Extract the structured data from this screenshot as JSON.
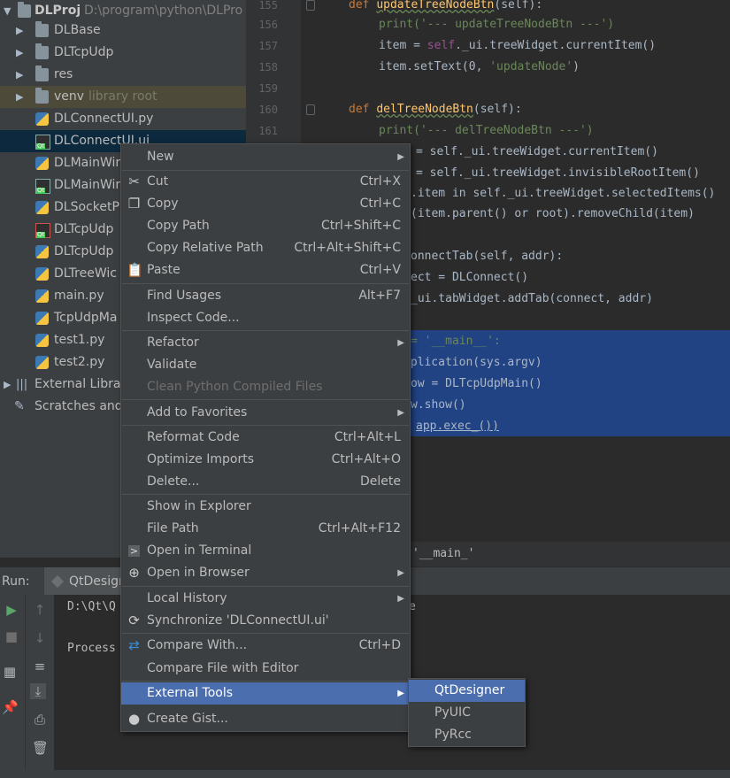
{
  "project": {
    "root_name": "DLProj",
    "root_path": "D:\\program\\python\\DLPro",
    "items": [
      {
        "label": "DLBase",
        "type": "folder"
      },
      {
        "label": "DLTcpUdp",
        "type": "folder"
      },
      {
        "label": "res",
        "type": "folder"
      },
      {
        "label": "venv",
        "hint": "library root",
        "type": "folder"
      },
      {
        "label": "DLConnectUI.py",
        "type": "py"
      },
      {
        "label": "DLConnectUI.ui",
        "type": "ui"
      },
      {
        "label": "DLMainWir",
        "type": "py"
      },
      {
        "label": "DLMainWir",
        "type": "ui"
      },
      {
        "label": "DLSocketP",
        "type": "py"
      },
      {
        "label": "DLTcpUdp",
        "type": "ui-red"
      },
      {
        "label": "DLTcpUdp",
        "type": "py"
      },
      {
        "label": "DLTreeWic",
        "type": "py"
      },
      {
        "label": "main.py",
        "type": "py"
      },
      {
        "label": "TcpUdpMa",
        "type": "py"
      },
      {
        "label": "test1.py",
        "type": "py"
      },
      {
        "label": "test2.py",
        "type": "py"
      }
    ],
    "external_libraries": "External Librar",
    "scratches": "Scratches and"
  },
  "editor": {
    "line_numbers": [
      "155",
      "156",
      "157",
      "158",
      "159",
      "160",
      "161"
    ],
    "lines": {
      "l155_kw": "def ",
      "l155_fn": "updateTreeNodeBtn",
      "l155_rest": "(self):",
      "l156": "print('--- updateTreeNodeBtn ---')",
      "l157_a": "item = ",
      "l157_self": "self",
      "l157_b": "._ui.treeWidget.currentItem()",
      "l158_a": "item.setText(0, ",
      "l158_str": "'updateNode'",
      "l158_b": ")",
      "l160_kw": "def ",
      "l160_fn": "delTreeNodeBtn",
      "l160_rest": "(self):",
      "l161": "print('--- delTreeNodeBtn ---')",
      "l162": "= self._ui.treeWidget.currentItem()",
      "l163": "= self._ui.treeWidget.invisibleRootItem()",
      "l164": ".item in self._ui.treeWidget.selectedItems()",
      "l165": "(item.parent() or root).removeChild(item)",
      "l167": "onnectTab(self, addr):",
      "l168": "ect = DLConnect()",
      "l169": "_ui.tabWidget.addTab(connect, addr)",
      "l171": "= '__main__':",
      "l172": "pplication(sys.argv)",
      "l173": "ow = DLTcpUdpMain()",
      "l174": "w.show()",
      "l175": "app.exec_())"
    },
    "breadcrumb": "'__main_'"
  },
  "run": {
    "label": "Run:",
    "tab": "QtDesign",
    "console_line1": "D:\\Qt\\Q",
    "console_line1_tail": "e",
    "console_line2": "Process"
  },
  "context_menu": {
    "items": [
      {
        "label": "New",
        "shortcut": "",
        "submenu": true
      },
      {
        "label": "Cut",
        "shortcut": "Ctrl+X",
        "icon": "scissors-icon"
      },
      {
        "label": "Copy",
        "shortcut": "Ctrl+C",
        "icon": "copy-icon"
      },
      {
        "label": "Copy Path",
        "shortcut": "Ctrl+Shift+C"
      },
      {
        "label": "Copy Relative Path",
        "shortcut": "Ctrl+Alt+Shift+C"
      },
      {
        "label": "Paste",
        "shortcut": "Ctrl+V",
        "icon": "paste-icon"
      },
      {
        "label": "Find Usages",
        "shortcut": "Alt+F7"
      },
      {
        "label": "Inspect Code...",
        "shortcut": ""
      },
      {
        "label": "Refactor",
        "shortcut": "",
        "submenu": true
      },
      {
        "label": "Validate",
        "shortcut": ""
      },
      {
        "label": "Clean Python Compiled Files",
        "shortcut": "",
        "disabled": true
      },
      {
        "label": "Add to Favorites",
        "shortcut": "",
        "submenu": true
      },
      {
        "label": "Reformat Code",
        "shortcut": "Ctrl+Alt+L"
      },
      {
        "label": "Optimize Imports",
        "shortcut": "Ctrl+Alt+O"
      },
      {
        "label": "Delete...",
        "shortcut": "Delete"
      },
      {
        "label": "Show in Explorer",
        "shortcut": ""
      },
      {
        "label": "File Path",
        "shortcut": "Ctrl+Alt+F12"
      },
      {
        "label": "Open in Terminal",
        "shortcut": "",
        "icon": "terminal-icon"
      },
      {
        "label": "Open in Browser",
        "shortcut": "",
        "submenu": true,
        "icon": "globe-icon"
      },
      {
        "label": "Local History",
        "shortcut": "",
        "submenu": true
      },
      {
        "label": "Synchronize 'DLConnectUI.ui'",
        "shortcut": "",
        "icon": "sync-icon"
      },
      {
        "label": "Compare With...",
        "shortcut": "Ctrl+D",
        "icon": "compare-icon"
      },
      {
        "label": "Compare File with Editor",
        "shortcut": ""
      },
      {
        "label": "External Tools",
        "shortcut": "",
        "submenu": true,
        "highlighted": true
      },
      {
        "label": "Create Gist...",
        "shortcut": "",
        "icon": "github-icon"
      }
    ]
  },
  "submenu": {
    "items": [
      "QtDesigner",
      "PyUIC",
      "PyRcc"
    ]
  },
  "colors": {
    "menu_highlight": "#4b6eaf",
    "selection": "#214283",
    "keyword": "#cc7832",
    "function": "#ffc66d",
    "string": "#6a8759"
  }
}
